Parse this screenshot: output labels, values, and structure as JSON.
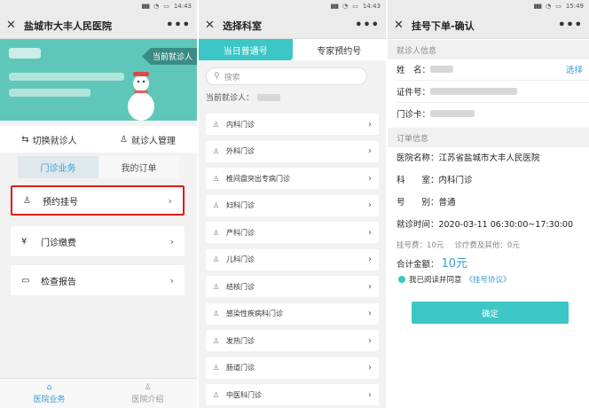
{
  "panel1": {
    "status_time": "14:43",
    "title": "盐城市大丰人民医院",
    "current_tag": "当前就诊人",
    "switch_patient": "切换就诊人",
    "manage_patient": "就诊人管理",
    "tabs": [
      "门诊业务",
      "我的订单"
    ],
    "menu": [
      "预约挂号",
      "门诊缴费",
      "检查报告"
    ],
    "bottom_nav": [
      "医院业务",
      "医院介绍"
    ],
    "colors": {
      "header": "#5fc7b9",
      "accent": "#3a9bd1",
      "highlight_border": "#e31b1b"
    }
  },
  "panel2": {
    "status_time": "14:43",
    "title": "选择科室",
    "tabs": [
      "当日普通号",
      "专家预约号"
    ],
    "search_placeholder": "搜索",
    "current_patient_label": "当前就诊人：",
    "departments": [
      "内科门诊",
      "外科门诊",
      "椎间盘突出专病门诊",
      "妇科门诊",
      "产科门诊",
      "儿科门诊",
      "结核门诊",
      "感染性疾病科门诊",
      "发热门诊",
      "肠道门诊",
      "中医科门诊"
    ],
    "colors": {
      "tab_active": "#3cc6c5"
    }
  },
  "panel3": {
    "status_time": "15:49",
    "title": "挂号下单-确认",
    "patient_section": "就诊人信息",
    "name_label": "姓　名：",
    "choose": "选择",
    "id_label": "证件号：",
    "card_label": "门诊卡：",
    "order_section": "订单信息",
    "hospital": "医院名称：江苏省盐城市大丰人民医院",
    "department": "科　　室：内科门诊",
    "number_type": "号　　别：普通",
    "visit_time": "就诊时间：2020-03-11 06:30:00~17:30:00",
    "reg_fee": "挂号费：10元",
    "other_fee": "诊疗费及其他：0元",
    "total_label": "合计金额：",
    "total_amount": "10元",
    "agree_text": "我已阅读并同意",
    "agreement_link": "《挂号协议》",
    "confirm": "确定",
    "colors": {
      "button": "#3cc6c5",
      "link": "#3a9bd1"
    }
  }
}
